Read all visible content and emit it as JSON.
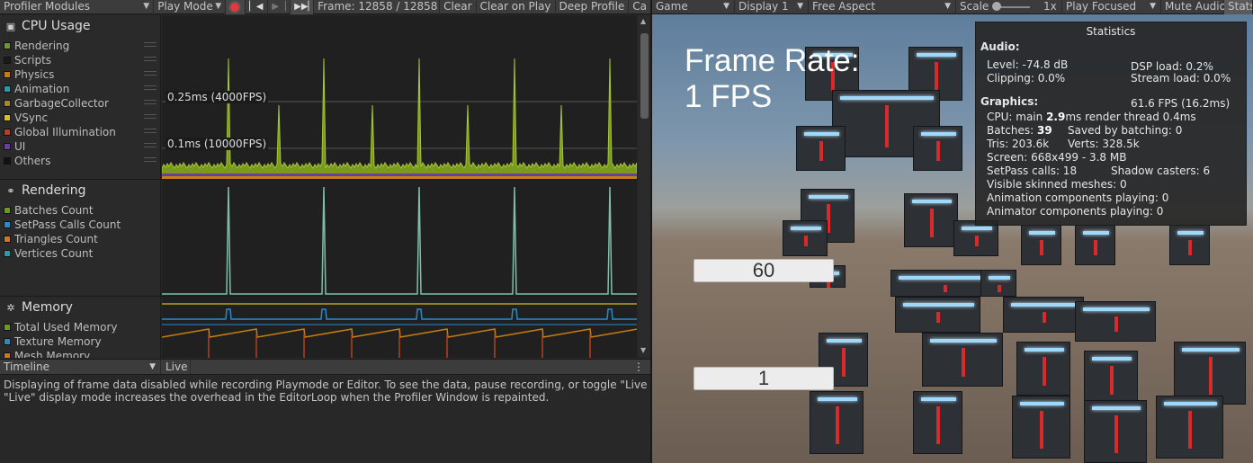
{
  "profiler": {
    "toolbar": {
      "modules": "Profiler Modules",
      "play_mode": "Play Mode",
      "frame": "Frame: 12858 / 12858",
      "clear": "Clear",
      "clear_on_play": "Clear on Play",
      "deep_profile": "Deep Profile",
      "cut": "Ca"
    },
    "modules": {
      "cpu": {
        "title": "CPU Usage",
        "items": [
          {
            "label": "Rendering",
            "color": "#6e9a1c"
          },
          {
            "label": "Scripts",
            "color": "#1a1a1a"
          },
          {
            "label": "Physics",
            "color": "#c87d13"
          },
          {
            "label": "Animation",
            "color": "#2a9aa8"
          },
          {
            "label": "GarbageCollector",
            "color": "#a08a23"
          },
          {
            "label": "VSync",
            "color": "#d8c219"
          },
          {
            "label": "Global Illumination",
            "color": "#b3401e"
          },
          {
            "label": "UI",
            "color": "#6a3ea0"
          },
          {
            "label": "Others",
            "color": "#111111"
          }
        ],
        "marker_high": "0.25ms (4000FPS)",
        "marker_low": "0.1ms (10000FPS)"
      },
      "rendering": {
        "title": "Rendering",
        "items": [
          {
            "label": "Batches Count",
            "color": "#6e9a1c"
          },
          {
            "label": "SetPass Calls Count",
            "color": "#2a8ac8"
          },
          {
            "label": "Triangles Count",
            "color": "#c87d13"
          },
          {
            "label": "Vertices Count",
            "color": "#2a9aa8"
          }
        ]
      },
      "memory": {
        "title": "Memory",
        "items": [
          {
            "label": "Total Used Memory",
            "color": "#6e9a1c"
          },
          {
            "label": "Texture Memory",
            "color": "#2a8ac8"
          },
          {
            "label": "Mesh Memory",
            "color": "#c87d13"
          }
        ]
      }
    },
    "timeline": {
      "view": "Timeline",
      "live": "Live"
    },
    "info": [
      "Displaying of frame data disabled while recording Playmode or Editor. To see the data, pause recording, or toggle \"Live\" display mode on.",
      " \"Live\" display mode increases the overhead in the EditorLoop when the Profiler Window is repainted."
    ]
  },
  "game": {
    "toolbar": {
      "tab": "Game",
      "display": "Display 1",
      "aspect": "Free Aspect",
      "scale_label": "Scale",
      "scale_value": "1x",
      "play_focused": "Play Focused",
      "mute": "Mute Audio",
      "stats": "Stats"
    },
    "frame_rate_text": "Frame Rate: 1 FPS",
    "field_top": "60",
    "field_bottom": "1",
    "statistics": {
      "title": "Statistics",
      "audio_heading": "Audio:",
      "level": "Level: -74.8 dB",
      "dsp": "DSP load: 0.2%",
      "clipping": "Clipping: 0.0%",
      "stream": "Stream load: 0.0%",
      "graphics_heading": "Graphics:",
      "fps": "61.6 FPS (16.2ms)",
      "cpu_prefix": "CPU: main ",
      "cpu_main": "2.9",
      "cpu_suffix": "ms  render thread 0.4ms",
      "batches_prefix": "Batches: ",
      "batches": "39",
      "saved": "Saved by batching: 0",
      "tris": "Tris: 203.6k",
      "verts": "Verts: 328.5k",
      "screen": "Screen: 668x499 - 3.8 MB",
      "setpass": "SetPass calls: 18",
      "shadow": "Shadow casters: 6",
      "skinned": "Visible skinned meshes: 0",
      "anim": "Animation components playing: 0",
      "animator": "Animator components playing: 0"
    }
  }
}
